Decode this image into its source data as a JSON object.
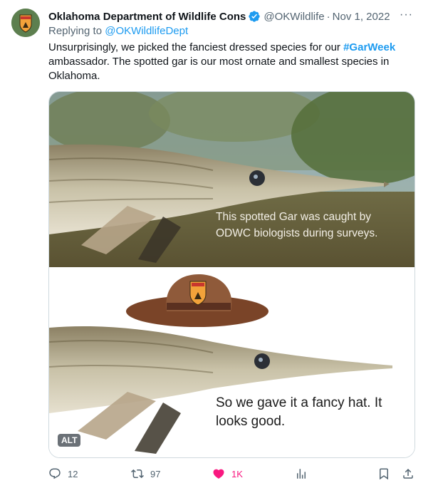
{
  "tweet": {
    "author_name": "Oklahoma Department of Wildlife Cons",
    "handle": "@OKWildlife",
    "separator": "·",
    "date": "Nov 1, 2022",
    "more_label": "···",
    "replying_prefix": "Replying to",
    "replying_to": "@OKWildlifeDept",
    "text_part1": "Unsurprisingly, we picked the fanciest dressed species for our",
    "hashtag": "#GarWeek",
    "text_part2": "ambassador. The spotted gar is our most ornate and smallest species in Oklahoma.",
    "media": {
      "caption_top": "This spotted Gar was caught by ODWC biologists during surveys.",
      "caption_bottom": "So we gave it a fancy hat. It looks good.",
      "alt_badge": "ALT"
    },
    "actions": {
      "replies": "12",
      "retweets": "97",
      "likes": "1K",
      "like_color": "#f91880"
    },
    "colors": {
      "link": "#1d9bf0",
      "muted": "#536471",
      "verified": "#1d9bf0"
    }
  }
}
